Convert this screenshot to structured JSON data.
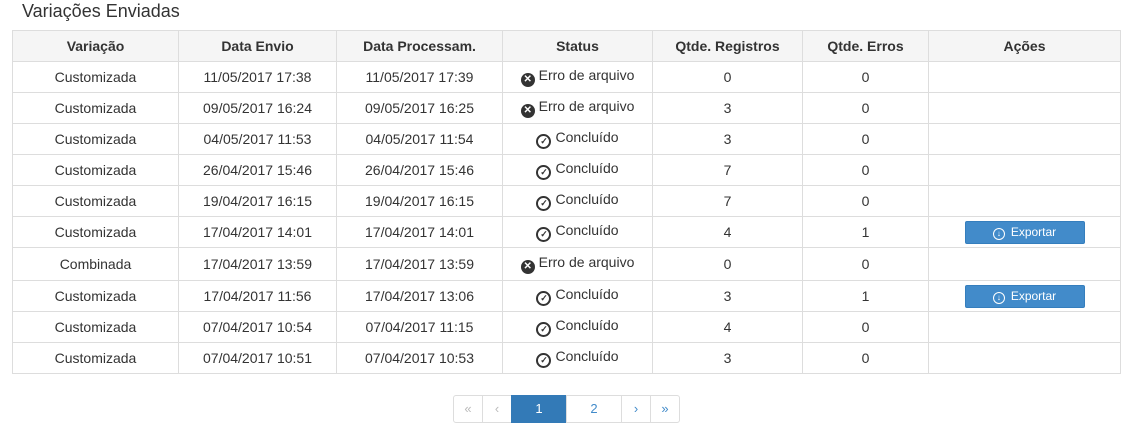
{
  "page": {
    "title": "Variações Enviadas"
  },
  "table": {
    "headers": [
      "Variação",
      "Data Envio",
      "Data Processam.",
      "Status",
      "Qtde. Registros",
      "Qtde. Erros",
      "Ações"
    ],
    "rows": [
      {
        "variacao": "Customizada",
        "data_envio": "11/05/2017 17:38",
        "data_proc": "11/05/2017 17:39",
        "status": "Erro de arquivo",
        "registros": "0",
        "erros": "0",
        "acao": ""
      },
      {
        "variacao": "Customizada",
        "data_envio": "09/05/2017 16:24",
        "data_proc": "09/05/2017 16:25",
        "status": "Erro de arquivo",
        "registros": "3",
        "erros": "0",
        "acao": ""
      },
      {
        "variacao": "Customizada",
        "data_envio": "04/05/2017 11:53",
        "data_proc": "04/05/2017 11:54",
        "status": "Concluído",
        "registros": "3",
        "erros": "0",
        "acao": ""
      },
      {
        "variacao": "Customizada",
        "data_envio": "26/04/2017 15:46",
        "data_proc": "26/04/2017 15:46",
        "status": "Concluído",
        "registros": "7",
        "erros": "0",
        "acao": ""
      },
      {
        "variacao": "Customizada",
        "data_envio": "19/04/2017 16:15",
        "data_proc": "19/04/2017 16:15",
        "status": "Concluído",
        "registros": "7",
        "erros": "0",
        "acao": ""
      },
      {
        "variacao": "Customizada",
        "data_envio": "17/04/2017 14:01",
        "data_proc": "17/04/2017 14:01",
        "status": "Concluído",
        "registros": "4",
        "erros": "1",
        "acao": "Exportar"
      },
      {
        "variacao": "Combinada",
        "data_envio": "17/04/2017 13:59",
        "data_proc": "17/04/2017 13:59",
        "status": "Erro de arquivo",
        "registros": "0",
        "erros": "0",
        "acao": ""
      },
      {
        "variacao": "Customizada",
        "data_envio": "17/04/2017 11:56",
        "data_proc": "17/04/2017 13:06",
        "status": "Concluído",
        "registros": "3",
        "erros": "1",
        "acao": "Exportar"
      },
      {
        "variacao": "Customizada",
        "data_envio": "07/04/2017 10:54",
        "data_proc": "07/04/2017 11:15",
        "status": "Concluído",
        "registros": "4",
        "erros": "0",
        "acao": ""
      },
      {
        "variacao": "Customizada",
        "data_envio": "07/04/2017 10:51",
        "data_proc": "07/04/2017 10:53",
        "status": "Concluído",
        "registros": "3",
        "erros": "0",
        "acao": ""
      }
    ]
  },
  "icons": {
    "error": "times-circle-icon",
    "ok": "check-circle-icon",
    "export": "download-circle-icon"
  },
  "pagination": {
    "first": "«",
    "prev": "‹",
    "pages": [
      "1",
      "2"
    ],
    "current": "1",
    "next": "›",
    "last": "»"
  },
  "colors": {
    "accent": "#337ab7",
    "button": "#428bca",
    "header_bg": "#f5f5f5",
    "border": "#dddddd"
  }
}
